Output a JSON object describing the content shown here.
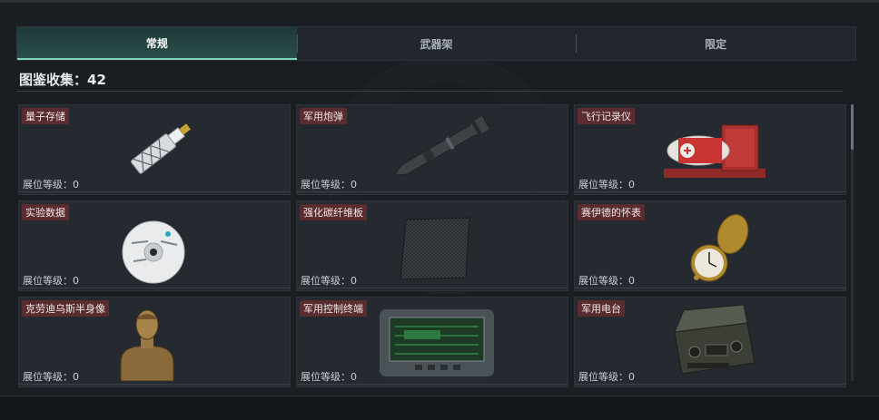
{
  "tabs": [
    {
      "label": "常规",
      "active": true
    },
    {
      "label": "武器架",
      "active": false
    },
    {
      "label": "限定",
      "active": false
    }
  ],
  "collection": {
    "label": "图鉴收集",
    "count": "42",
    "text": "图鉴收集：42"
  },
  "items": [
    {
      "name": "量子存储",
      "level_text": "展位等级：0",
      "level": 0,
      "icon": "usb-drive-icon"
    },
    {
      "name": "军用炮弹",
      "level_text": "展位等级：0",
      "level": 0,
      "icon": "artillery-shell-icon"
    },
    {
      "name": "飞行记录仪",
      "level_text": "展位等级：0",
      "level": 0,
      "icon": "flight-recorder-icon"
    },
    {
      "name": "实验数据",
      "level_text": "展位等级：0",
      "level": 0,
      "icon": "disc-icon"
    },
    {
      "name": "强化碳纤维板",
      "level_text": "展位等级：0",
      "level": 0,
      "icon": "carbon-plate-icon"
    },
    {
      "name": "赛伊德的怀表",
      "level_text": "展位等级：0",
      "level": 0,
      "icon": "pocket-watch-icon"
    },
    {
      "name": "克劳迪乌斯半身像",
      "level_text": "展位等级：0",
      "level": 0,
      "icon": "bust-icon"
    },
    {
      "name": "军用控制终端",
      "level_text": "展位等级：0",
      "level": 0,
      "icon": "control-terminal-icon"
    },
    {
      "name": "军用电台",
      "level_text": "展位等级：0",
      "level": 0,
      "icon": "radio-icon"
    }
  ],
  "colors": {
    "accent": "#7fd6b8",
    "name_badge": "#5a2c2f",
    "card_bg": "#252a31",
    "page_bg": "#1a1e23"
  }
}
